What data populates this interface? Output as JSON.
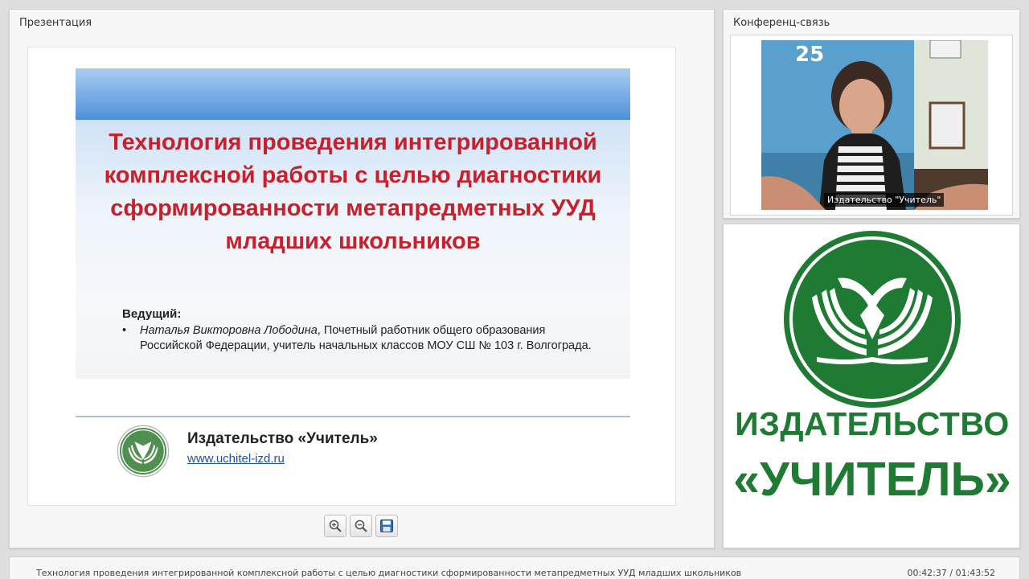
{
  "presentation_panel": {
    "title": "Презентация"
  },
  "slide": {
    "title": "Технология проведения интегрированной комплексной работы с целью диагностики сформированности метапредметных УУД младших школьников",
    "host_label": "Ведущий:",
    "host_bullet": "•",
    "host_name": "Наталья Викторовна Лободина",
    "host_description": ", Почетный работник общего образования Российской Федерации, учитель начальных классов МОУ СШ № 103 г. Волгограда.",
    "publisher_name": "Издательство «Учитель»",
    "publisher_url": "www.uchitel-izd.ru"
  },
  "toolbar": {
    "zoom_in_icon": "zoom-in-icon",
    "zoom_out_icon": "zoom-out-icon",
    "save_icon": "save-icon"
  },
  "conference_panel": {
    "title": "Конференц-связь",
    "participant_label": "Издательство \"Учитель\""
  },
  "brand_panel": {
    "line1": "ИЗДАТЕЛЬСТВО",
    "line2": "«УЧИТЕЛЬ»"
  },
  "footer": {
    "title": "Технология проведения интегрированной комплексной работы с целью диагностики сформированности метапредметных УУД младших школьников",
    "time": "00:42:37 / 01:43:52"
  },
  "colors": {
    "brand_green": "#1f7a34",
    "slide_title_red": "#c81f2a",
    "link_blue": "#1a4fb5"
  }
}
